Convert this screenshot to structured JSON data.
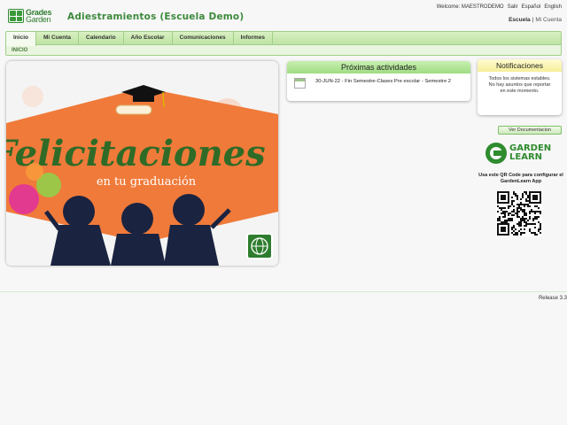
{
  "brand": {
    "line1": "Grades",
    "line2": "Garden"
  },
  "app_title": "Adiestramientos (Escuela Demo)",
  "top_links": {
    "welcome": "Welcome: MAESTRODEMO",
    "logout": "Salir",
    "lang_es": "Español",
    "lang_en": "English"
  },
  "school_links": {
    "school": "Escuela",
    "separator": "|",
    "my_account": "Mi Cuenta"
  },
  "nav": {
    "tabs": [
      {
        "label": "Inicio",
        "active": true
      },
      {
        "label": "Mi Cuenta",
        "active": false
      },
      {
        "label": "Calendario",
        "active": false
      },
      {
        "label": "Año Escolar",
        "active": false
      },
      {
        "label": "Comunicaciones",
        "active": false
      },
      {
        "label": "Informes",
        "active": false
      }
    ],
    "breadcrumb": "INICIO"
  },
  "banner": {
    "headline": "Felicitaciones",
    "subline": "en tu graduación"
  },
  "activities": {
    "title": "Próximas actividades",
    "items": [
      {
        "text": "30-JUN-22 - Fin Semestre-Clases Pre escolar - Semestre 2"
      }
    ]
  },
  "notifications": {
    "title": "Notificaciones",
    "message": "Todos los sistemas estables. No hay asuntos que reportar en este momento."
  },
  "documentation_button": "Ver Documentacion",
  "gardenlearn": {
    "line1": "GARDEN",
    "line2": "LEARN",
    "qr_caption": "Usa este QR Code para configurar el GardenLearn App"
  },
  "release": "Release 3.3",
  "colors": {
    "accent_green": "#3d8a3d",
    "tab_bar": "#bfe3a3",
    "banner_orange": "#f07a3a",
    "notif_header": "#f6ef9a"
  },
  "icons": [
    "grades-garden-logo-icon",
    "calendar-icon",
    "globe-icon",
    "gardenlearn-logo-icon",
    "qr-code-icon",
    "graduation-cap-icon"
  ]
}
